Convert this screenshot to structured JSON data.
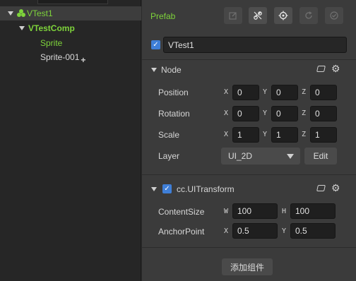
{
  "hierarchy": {
    "items": [
      {
        "label": "VTest1"
      },
      {
        "label": "VTestComp"
      },
      {
        "label": "Sprite"
      },
      {
        "label": "Sprite-001"
      }
    ]
  },
  "inspector": {
    "type_label": "Prefab",
    "toolbar_icons": [
      "edit-icon",
      "unlink-icon",
      "locate-icon",
      "revert-icon",
      "apply-icon"
    ],
    "node_name": "VTest1",
    "node_section": {
      "title": "Node",
      "position": {
        "label": "Position",
        "x": "0",
        "y": "0",
        "z": "0"
      },
      "rotation": {
        "label": "Rotation",
        "x": "0",
        "y": "0",
        "z": "0"
      },
      "scale": {
        "label": "Scale",
        "x": "1",
        "y": "1",
        "z": "1"
      },
      "layer": {
        "label": "Layer",
        "value": "UI_2D",
        "edit_label": "Edit"
      }
    },
    "uitransform": {
      "title": "cc.UITransform",
      "content_size": {
        "label": "ContentSize",
        "w": "100",
        "h": "100"
      },
      "anchor_point": {
        "label": "AnchorPoint",
        "x": "0.5",
        "y": "0.5"
      }
    },
    "add_component_label": "添加组件"
  },
  "axes": {
    "x": "X",
    "y": "Y",
    "z": "Z",
    "w": "W",
    "h": "H"
  },
  "colors": {
    "green": "#7ed33b",
    "checkbox": "#3f7fd8",
    "panel": "#3b3b3b"
  }
}
